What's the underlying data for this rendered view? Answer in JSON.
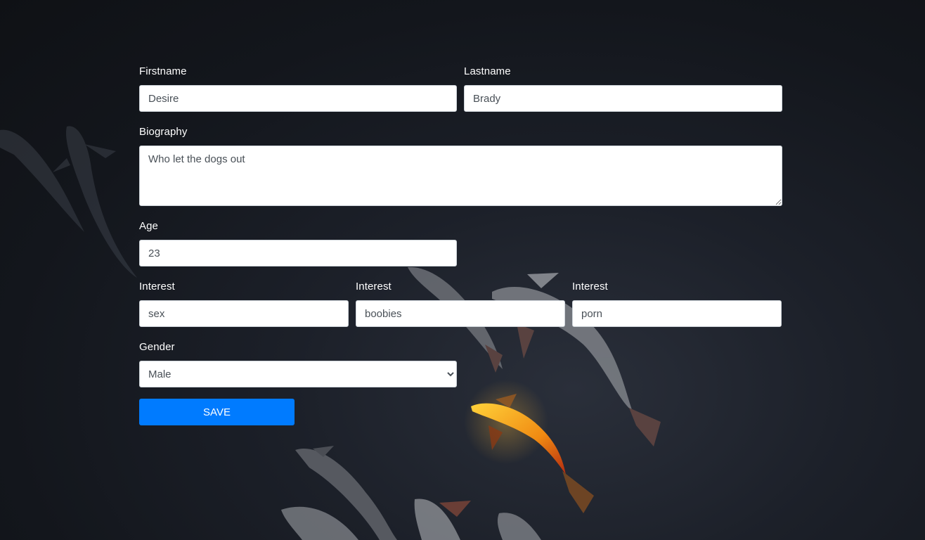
{
  "form": {
    "firstname": {
      "label": "Firstname",
      "value": "Desire"
    },
    "lastname": {
      "label": "Lastname",
      "value": "Brady"
    },
    "biography": {
      "label": "Biography",
      "value": "Who let the dogs out"
    },
    "age": {
      "label": "Age",
      "value": "23"
    },
    "interests": [
      {
        "label": "Interest",
        "value": "sex"
      },
      {
        "label": "Interest",
        "value": "boobies"
      },
      {
        "label": "Interest",
        "value": "porn"
      }
    ],
    "gender": {
      "label": "Gender",
      "value": "Male",
      "options": [
        "Male"
      ]
    },
    "save_label": "SAVE"
  },
  "colors": {
    "background": "#13161c",
    "button": "#007bff",
    "koi_accent": "#f3a21a"
  },
  "background_image": {
    "icon": "koi-fish-illustration"
  }
}
